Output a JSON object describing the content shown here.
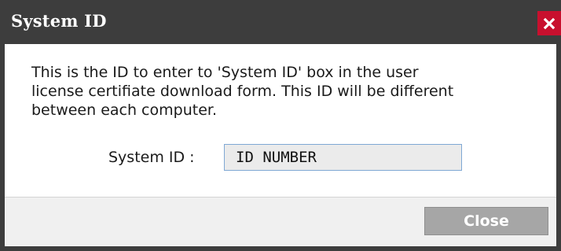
{
  "window": {
    "title": "System ID",
    "close_icon": "close-icon"
  },
  "body": {
    "message": "This is the ID to enter to 'System ID' box in the user\nlicense certifiate download form. This ID will be different\nbetween each computer.",
    "system_id_label": "System ID :",
    "system_id_value": "ID NUMBER"
  },
  "footer": {
    "close_label": "Close"
  },
  "colors": {
    "titlebar": "#3d3d3d",
    "close_x_background": "#c8102e",
    "button_background": "#a6a6a6"
  }
}
